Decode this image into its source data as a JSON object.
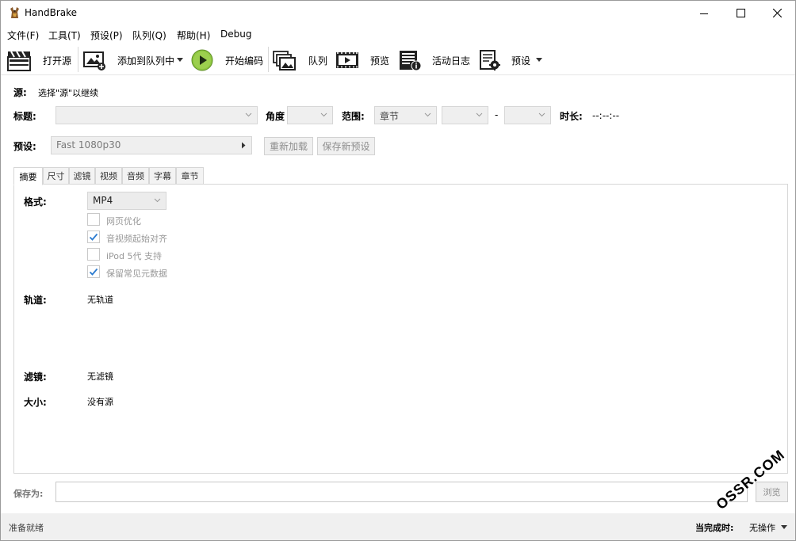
{
  "window": {
    "title": "HandBrake"
  },
  "menu": [
    "文件(F)",
    "工具(T)",
    "预设(P)",
    "队列(Q)",
    "帮助(H)",
    "Debug"
  ],
  "toolbar": {
    "open_source": "打开源",
    "add_to_queue": "添加到队列中",
    "start_encode": "开始编码",
    "queue": "队列",
    "preview": "预览",
    "activity_log": "活动日志",
    "presets": "预设"
  },
  "source": {
    "label": "源:",
    "value": "选择\"源\"以继续"
  },
  "title_row": {
    "title_label": "标题:",
    "angle_label": "角度",
    "range_label": "范围:",
    "range_value": "章节",
    "dash": "-",
    "duration_label": "时长:",
    "duration_value": "--:--:--"
  },
  "preset_row": {
    "label": "预设:",
    "value": "Fast 1080p30",
    "reload": "重新加载",
    "save_new": "保存新预设"
  },
  "tabs": [
    "摘要",
    "尺寸",
    "滤镜",
    "视频",
    "音频",
    "字幕",
    "章节"
  ],
  "summary": {
    "format_label": "格式:",
    "format_value": "MP4",
    "options": [
      {
        "label": "网页优化",
        "checked": false
      },
      {
        "label": "音视频起始对齐",
        "checked": true
      },
      {
        "label": "iPod 5代 支持",
        "checked": false
      },
      {
        "label": "保留常见元数据",
        "checked": true
      }
    ],
    "tracks_label": "轨道:",
    "tracks_value": "无轨道",
    "filters_label": "滤镜:",
    "filters_value": "无滤镜",
    "size_label": "大小:",
    "size_value": "没有源"
  },
  "save_as": {
    "label": "保存为:",
    "browse": "浏览"
  },
  "status": {
    "left": "准备就绪",
    "when_done_label": "当完成时:",
    "when_done_value": "无操作"
  },
  "watermark": "OSSR.COM"
}
